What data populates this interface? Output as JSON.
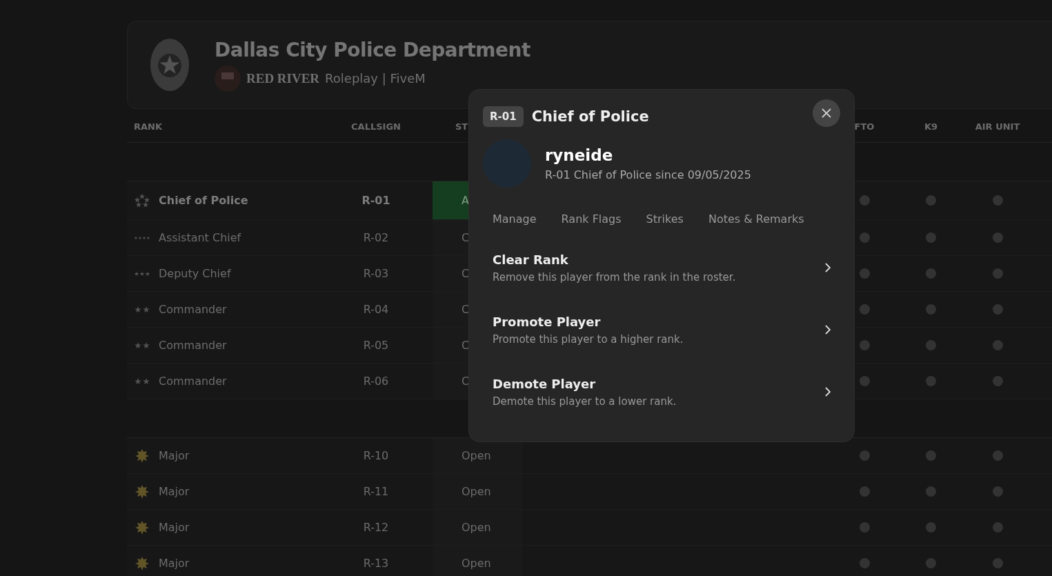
{
  "header": {
    "title": "Dallas City Police Department",
    "brand": "RED RIVER",
    "subtitle": "Roleplay | FiveM"
  },
  "table": {
    "columns": [
      "RANK",
      "CALLSIGN",
      "ST",
      "FTO",
      "K9",
      "AIR UNIT"
    ],
    "groups": [
      {
        "rows": [
          {
            "kind": "wreath",
            "rank": "Chief of Police",
            "callsign": "R-01",
            "status": {
              "text": "A",
              "kind": "assigned"
            },
            "flags": [
              false,
              false,
              false
            ]
          },
          {
            "kind": "four-star",
            "rank": "Assistant Chief",
            "callsign": "R-02",
            "status": {
              "text": "C",
              "kind": "open"
            },
            "flags": [
              false,
              false,
              false
            ]
          },
          {
            "kind": "three-star",
            "rank": "Deputy Chief",
            "callsign": "R-03",
            "status": {
              "text": "C",
              "kind": "open"
            },
            "flags": [
              false,
              false,
              false
            ]
          },
          {
            "kind": "two-star",
            "rank": "Commander",
            "callsign": "R-04",
            "status": {
              "text": "C",
              "kind": "open"
            },
            "flags": [
              false,
              false,
              false
            ]
          },
          {
            "kind": "two-star",
            "rank": "Commander",
            "callsign": "R-05",
            "status": {
              "text": "C",
              "kind": "open"
            },
            "flags": [
              false,
              false,
              false
            ]
          },
          {
            "kind": "two-star",
            "rank": "Commander",
            "callsign": "R-06",
            "status": {
              "text": "C",
              "kind": "open"
            },
            "flags": [
              false,
              false,
              false
            ]
          }
        ]
      },
      {
        "rows": [
          {
            "kind": "oak-leaf",
            "rank": "Major",
            "callsign": "R-10",
            "status": {
              "text": "Open",
              "kind": "open"
            },
            "flags": [
              false,
              false,
              false
            ]
          },
          {
            "kind": "oak-leaf",
            "rank": "Major",
            "callsign": "R-11",
            "status": {
              "text": "Open",
              "kind": "open"
            },
            "flags": [
              false,
              false,
              false
            ]
          },
          {
            "kind": "oak-leaf",
            "rank": "Major",
            "callsign": "R-12",
            "status": {
              "text": "Open",
              "kind": "open"
            },
            "flags": [
              false,
              false,
              false
            ]
          },
          {
            "kind": "oak-leaf",
            "rank": "Major",
            "callsign": "R-13",
            "status": {
              "text": "Open",
              "kind": "open"
            },
            "flags": [
              false,
              false,
              false
            ]
          }
        ]
      }
    ]
  },
  "modal": {
    "badge": "R-01",
    "title": "Chief of Police",
    "user": {
      "name": "ryneide",
      "since": "R-01 Chief of Police since 09/05/2025"
    },
    "tabs": [
      {
        "label": "Manage",
        "selected": false
      },
      {
        "label": "Rank Flags",
        "selected": false
      },
      {
        "label": "Strikes",
        "selected": false
      },
      {
        "label": "Notes & Remarks",
        "selected": false
      }
    ],
    "actions": [
      {
        "title": "Clear Rank",
        "description": "Remove this player from the rank in the roster."
      },
      {
        "title": "Promote Player",
        "description": "Promote this player to a higher rank."
      },
      {
        "title": "Demote Player",
        "description": "Demote this player to a lower rank."
      }
    ]
  }
}
